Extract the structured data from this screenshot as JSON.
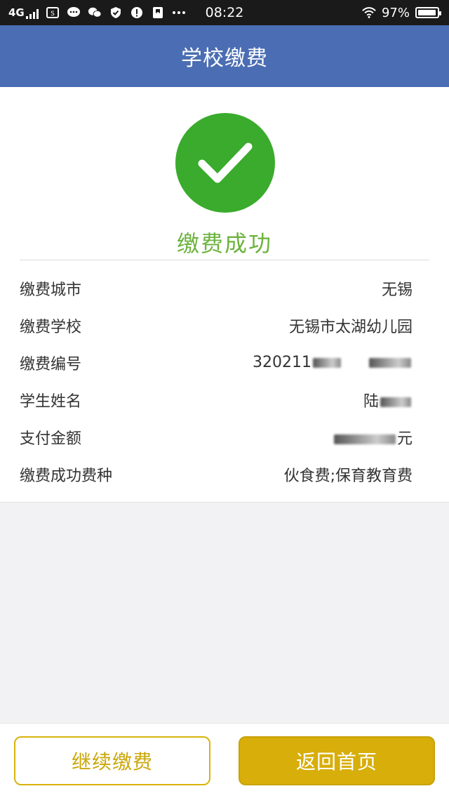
{
  "status_bar": {
    "network": "4G",
    "time": "08:22",
    "battery": "97%",
    "battery_level": 0.97,
    "icons": [
      "signal-icon",
      "sim-icon",
      "chat-bubble-icon",
      "wechat-icon",
      "shield-icon",
      "alert-icon",
      "bookmark-icon",
      "more-icon",
      "wifi-icon",
      "battery-icon"
    ]
  },
  "header": {
    "title": "学校缴费"
  },
  "result": {
    "title": "缴费成功",
    "icon": "checkmark-icon",
    "color": "#3aab2c"
  },
  "details": [
    {
      "label": "缴费城市",
      "value": "无锡"
    },
    {
      "label": "缴费学校",
      "value": "无锡市太湖幼儿园"
    },
    {
      "label": "缴费编号",
      "value": "320211"
    },
    {
      "label": "学生姓名",
      "value": "陆"
    },
    {
      "label": "支付金额",
      "value": "元"
    },
    {
      "label": "缴费成功费种",
      "value": "伙食费;保育教育费"
    }
  ],
  "buttons": {
    "continue_label": "继续缴费",
    "home_label": "返回首页"
  },
  "colors": {
    "header": "#4a6db3",
    "accent_gold": "#d7ae0a",
    "success_green": "#3aab2c",
    "success_text": "#6cb33e"
  }
}
